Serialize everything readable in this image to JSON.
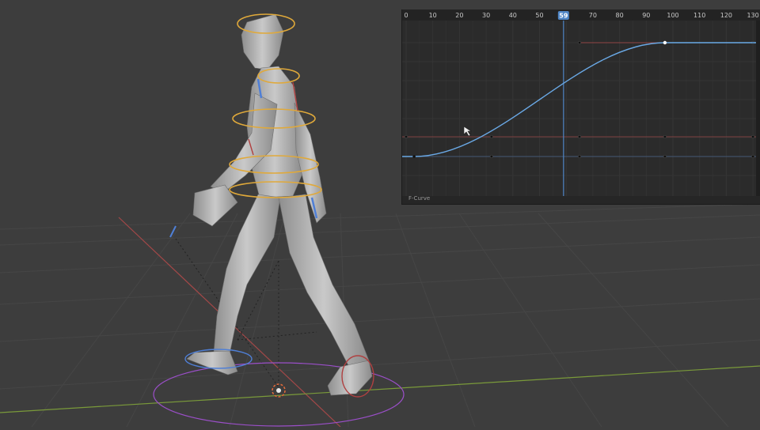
{
  "graph_editor": {
    "ruler_labels": [
      "0",
      "10",
      "20",
      "30",
      "40",
      "50",
      "70",
      "80",
      "90",
      "100",
      "110",
      "120",
      "130"
    ],
    "current_frame": "59",
    "footer_label": "F-Curve",
    "colors": {
      "curve": "#6aa9e6",
      "playhead": "#4f86c6",
      "x_channel": "#b04a4a",
      "y_channel": "#4d6a94",
      "background": "#2b2b2b"
    }
  },
  "viewport": {
    "colors": {
      "background": "#3d3d3d",
      "x_axis": "#a34848",
      "y_axis": "#7a9a3a",
      "bone_rings": "#e0a93a",
      "ik_ring": "#9b4fc9",
      "mesh": "#a8a8a8"
    },
    "icons": [
      "mouse-cursor-icon",
      "origin-icon"
    ]
  }
}
